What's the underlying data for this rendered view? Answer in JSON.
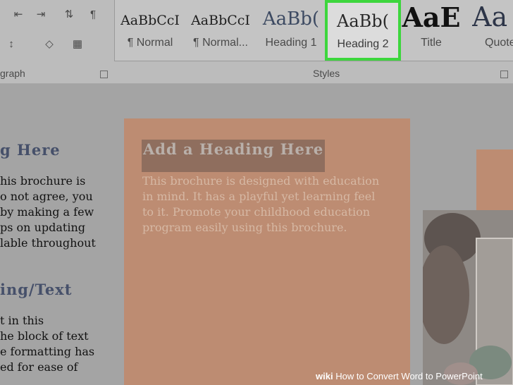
{
  "ribbon": {
    "paragraph_group_label": "graph",
    "styles_group_label": "Styles",
    "styles": [
      {
        "preview": "AaBbCcI",
        "name": "¶ Normal",
        "selected": false
      },
      {
        "preview": "AaBbCcI",
        "name": "¶ Normal...",
        "selected": false
      },
      {
        "preview": "AaBb(",
        "name": "Heading 1",
        "selected": false
      },
      {
        "preview": "AaBb(",
        "name": "Heading 2",
        "selected": true
      },
      {
        "preview": "AaE",
        "name": "Title",
        "selected": false
      },
      {
        "preview": "Aa",
        "name": "Quote",
        "selected": false
      }
    ],
    "highlight_color": "#3dd63d"
  },
  "document": {
    "left_column": {
      "heading1": "g Here",
      "lines1": [
        "his brochure is",
        "o not agree, you",
        "by making a few",
        "ps on updating",
        "lable throughout"
      ],
      "heading2": "ing/Text",
      "lines2": [
        "t in this",
        "he block of text",
        "e formatting has",
        "ed for ease of"
      ]
    },
    "panel": {
      "heading": "Add a Heading Here",
      "lines": [
        "This brochure is designed with education",
        "in mind.  It has a playful yet learning feel",
        "to it.  Promote your childhood education",
        "program easily using this brochure."
      ]
    }
  },
  "watermark": {
    "brand": "wiki",
    "title": "How to Convert Word to PowerPoint"
  }
}
